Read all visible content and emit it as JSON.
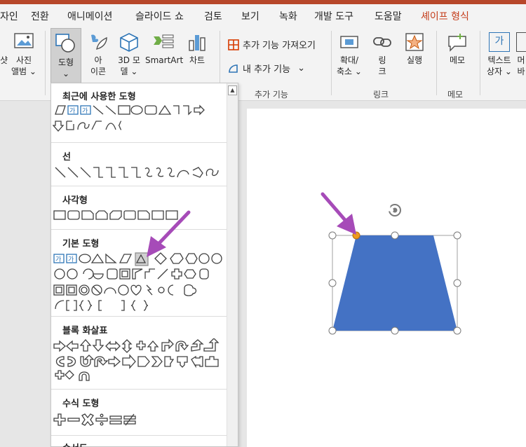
{
  "tabs": [
    "자인",
    "전환",
    "애니메이션",
    "슬라이드 쇼",
    "검토",
    "보기",
    "녹화",
    "개발 도구",
    "도움말",
    "셰이프 형식"
  ],
  "ribbon": {
    "screenshot_label": "샷",
    "picture_label1": "사진",
    "picture_label2": "앨범 ⌄",
    "shapes_label": "도형",
    "shapes_caret": "⌄",
    "icons_label1": "아",
    "icons_label2": "이콘",
    "models_label1": "3D 모",
    "models_label2": "델 ⌄",
    "smartart_label": "SmartArt",
    "chart_label": "차트",
    "get_addins_label": "추가 기능 가져오기",
    "my_addins_label": "내 추가 기능",
    "my_addins_caret": "⌄",
    "addins_group": "추가 기능",
    "zoom_label1": "확대/",
    "zoom_label2": "축소 ⌄",
    "link_label1": "링",
    "link_label2": "크",
    "action_label": "실행",
    "links_group": "링크",
    "comment_label": "메모",
    "comment_group": "메모",
    "textbox_label1": "텍스트",
    "textbox_label2": "상자 ⌄",
    "textbox_icon_text": "가",
    "header_label1": "머",
    "header_label2": "바",
    "accent_color": "#c43e1c"
  },
  "gallery": {
    "recent": "최근에 사용한 도형",
    "lines": "선",
    "rectangles": "사각형",
    "basic": "기본 도형",
    "block_arrows": "블록 화살표",
    "equation": "수식 도형",
    "flowchart": "순서도",
    "textbox_glyph": "가",
    "recent_row1": "\\＼□○▭△ᒣᒣ⇨",
    "recent_row2": "⇩ᑕℓ╮╮{",
    "lines_row": "＼＼ヽᒣᒣᒣᒣ 2 2 2 ∿ᑕℓ",
    "rect_row": "□□□□□□□□□",
    "basic_row1_tail": "○△◺▱",
    "basic_row1_end": "◇⬠⬡⑦⑧",
    "basic_row2": "⑩⑫ᑕ◔▢◫◸◺╱✚✚⌷",
    "basic_row3": "◘▣◎⊘⌒☺♡ϟ☼☾✿",
    "basic_row4": "╮[]{}[ ]{ }",
    "block_row1": "⇨⇦⇧⇩⇔⇕✥⊥↱↶↲↳",
    "block_row2": "↺↻↶↷⇛⇨▷⋙⊳⇩⇦⇧",
    "block_row3": "✥✥↶",
    "equation_row": "✚━✖➗〓≠"
  },
  "selection": {
    "fill_color": "#4472c4",
    "adjust_handle_color": "#ed9a1d",
    "arrow_color": "#a64bb8"
  }
}
